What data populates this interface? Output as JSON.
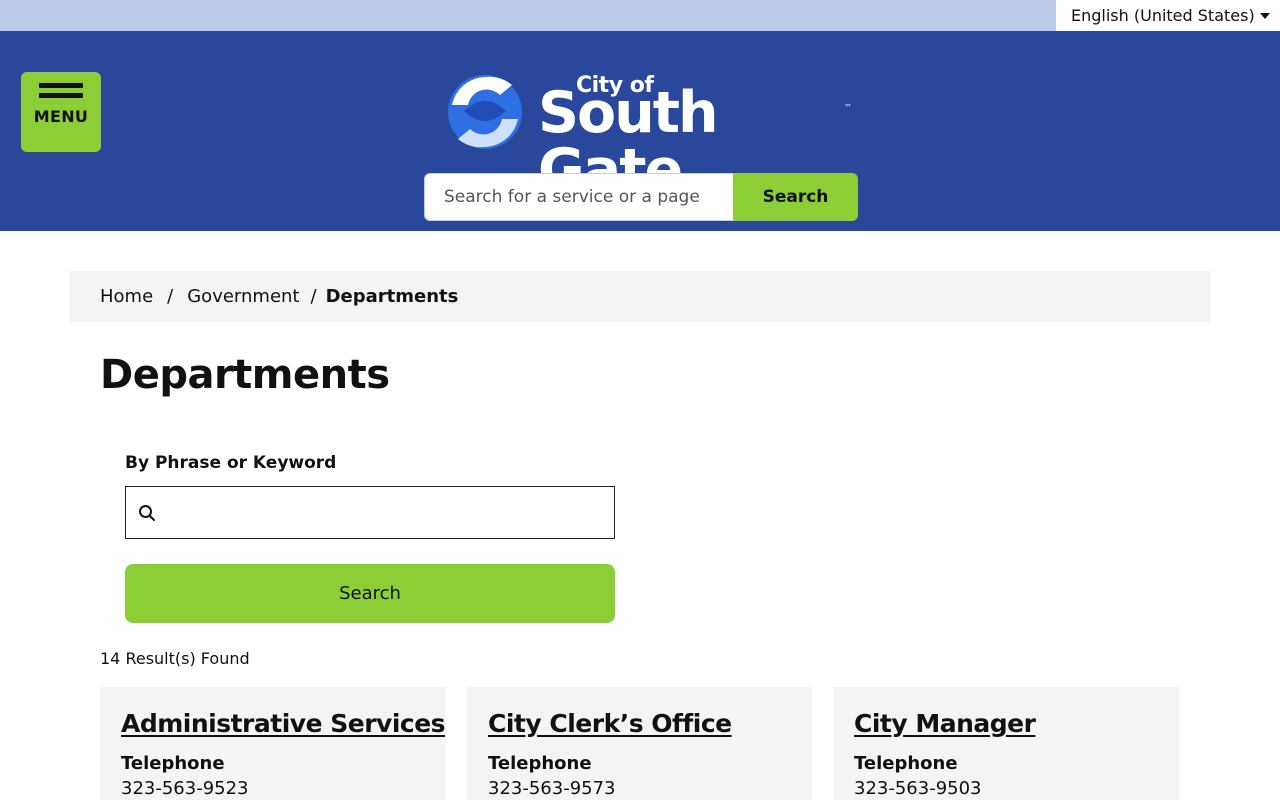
{
  "language": {
    "selected": "English (United States)"
  },
  "header": {
    "menu_label": "MENU",
    "logo": {
      "line1": "City of",
      "line2": "South Gate",
      "tm": "™"
    },
    "search": {
      "placeholder": "Search for a service or a page",
      "button": "Search"
    }
  },
  "breadcrumb": {
    "home": "Home",
    "sep": "/",
    "parent": "Government",
    "current": "Departments"
  },
  "page": {
    "title": "Departments"
  },
  "filter": {
    "label": "By Phrase or Keyword",
    "value": "",
    "button": "Search"
  },
  "results": {
    "count_text": "14 Result(s) Found",
    "items": [
      {
        "title": "Administrative Services",
        "phone_label": "Telephone",
        "phone": "323-563-9523"
      },
      {
        "title": "City Clerk’s Office",
        "phone_label": "Telephone",
        "phone": "323-563-9573"
      },
      {
        "title": "City Manager",
        "phone_label": "Telephone",
        "phone": "323-563-9503"
      }
    ]
  },
  "colors": {
    "header_bg": "#2a489b",
    "topbar_bg": "#bdcbe9",
    "accent_green": "#8cce35",
    "card_bg": "#f4f4f4"
  },
  "icons": {
    "menu": "hamburger-icon",
    "search": "magnifier-icon",
    "dropdown": "caret-down-icon",
    "logo": "city-logo-icon"
  }
}
